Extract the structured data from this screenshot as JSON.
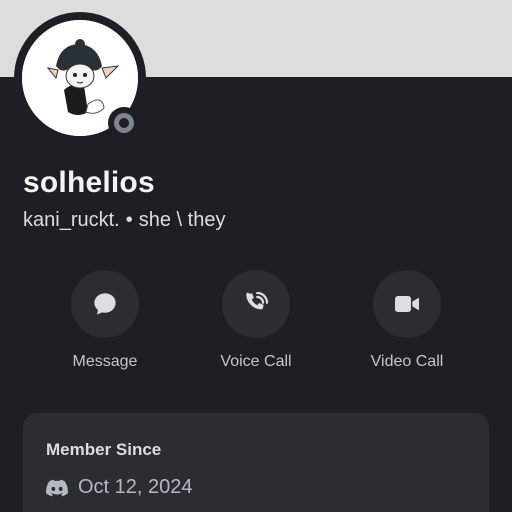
{
  "profile": {
    "display_name": "solhelios",
    "username": "kani_ruckt.",
    "separator": "•",
    "pronouns": "she \\ they",
    "status": "offline",
    "banner_color": "#dcdddd"
  },
  "actions": [
    {
      "label": "Message",
      "icon": "message-bubble-icon"
    },
    {
      "label": "Voice Call",
      "icon": "phone-call-icon"
    },
    {
      "label": "Video Call",
      "icon": "video-camera-icon"
    }
  ],
  "member_since": {
    "title": "Member Since",
    "icon": "discord-logo-icon",
    "date": "Oct 12, 2024"
  },
  "colors": {
    "background": "#1e1f24",
    "surface": "#2b2d33",
    "status_offline": "#80848e"
  }
}
